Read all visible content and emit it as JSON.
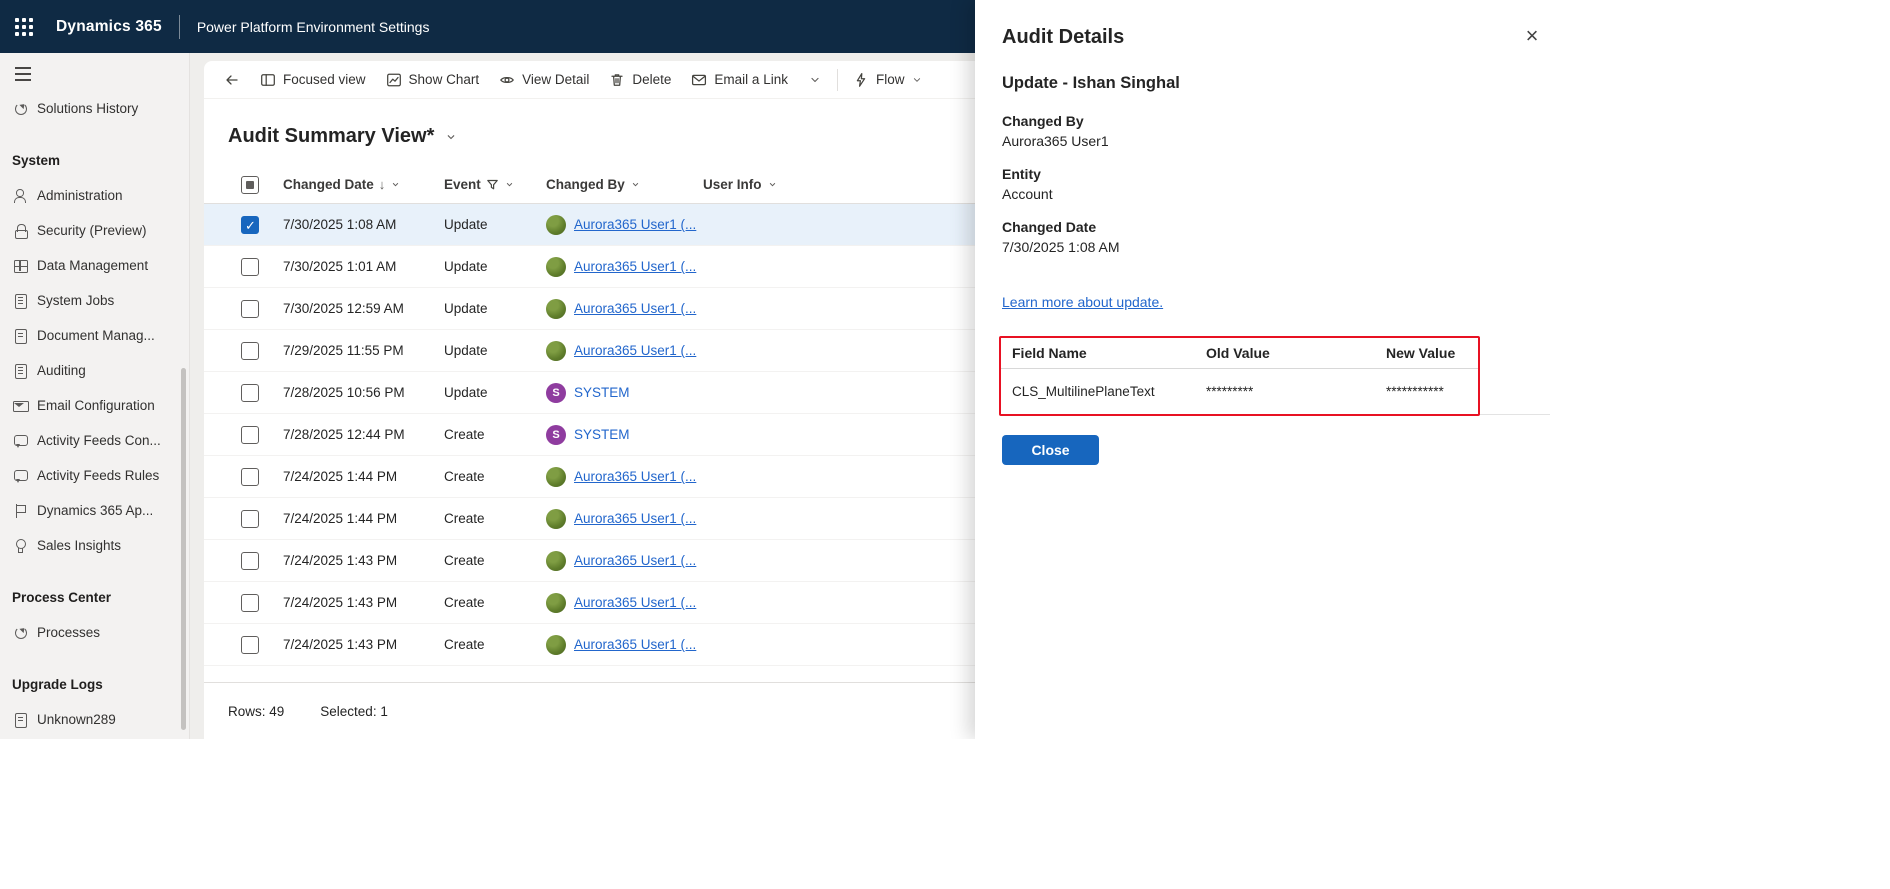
{
  "colors": {
    "topbar_bg": "#0f2a44",
    "accent": "#1766be",
    "link": "#2266cc",
    "selected_row_bg": "#e8f1fa",
    "highlight_border": "#e81123",
    "user_avatar": "#5f7d2b",
    "system_avatar": "#8f3c9f"
  },
  "topbar": {
    "app_name": "Dynamics 365",
    "page_title": "Power Platform Environment Settings"
  },
  "sidebar": {
    "entries": [
      {
        "type": "item",
        "label": "Solutions History",
        "icon": "history-icon"
      },
      {
        "type": "header",
        "label": "System"
      },
      {
        "type": "item",
        "label": "Administration",
        "icon": "people-icon"
      },
      {
        "type": "item",
        "label": "Security (Preview)",
        "icon": "lock-icon"
      },
      {
        "type": "item",
        "label": "Data Management",
        "icon": "database-icon"
      },
      {
        "type": "item",
        "label": "System Jobs",
        "icon": "system-jobs-icon"
      },
      {
        "type": "item",
        "label": "Document Manag...",
        "icon": "document-icon"
      },
      {
        "type": "item",
        "label": "Auditing",
        "icon": "audit-icon"
      },
      {
        "type": "item",
        "label": "Email Configuration",
        "icon": "email-icon"
      },
      {
        "type": "item",
        "label": "Activity Feeds Con...",
        "icon": "feed-icon"
      },
      {
        "type": "item",
        "label": "Activity Feeds Rules",
        "icon": "feed-rules-icon"
      },
      {
        "type": "item",
        "label": "Dynamics 365 Ap...",
        "icon": "apps-icon"
      },
      {
        "type": "item",
        "label": "Sales Insights",
        "icon": "insights-icon"
      },
      {
        "type": "header",
        "label": "Process Center"
      },
      {
        "type": "item",
        "label": "Processes",
        "icon": "processes-icon"
      },
      {
        "type": "header",
        "label": "Upgrade Logs"
      },
      {
        "type": "item",
        "label": "Unknown289",
        "icon": "log-icon"
      }
    ]
  },
  "command_bar": {
    "focused_view": "Focused view",
    "show_chart": "Show Chart",
    "view_detail": "View Detail",
    "delete": "Delete",
    "email_link": "Email a Link",
    "flow": "Flow"
  },
  "view": {
    "title": "Audit Summary View*"
  },
  "grid": {
    "columns": [
      "Changed Date",
      "Event",
      "Changed By",
      "User Info"
    ],
    "rows": [
      {
        "changed_date": "7/30/2025 1:08 AM",
        "event": "Update",
        "changed_by": "Aurora365 User1 (...",
        "avatar": "user",
        "selected": true
      },
      {
        "changed_date": "7/30/2025 1:01 AM",
        "event": "Update",
        "changed_by": "Aurora365 User1 (...",
        "avatar": "user",
        "selected": false
      },
      {
        "changed_date": "7/30/2025 12:59 AM",
        "event": "Update",
        "changed_by": "Aurora365 User1 (...",
        "avatar": "user",
        "selected": false
      },
      {
        "changed_date": "7/29/2025 11:55 PM",
        "event": "Update",
        "changed_by": "Aurora365 User1 (...",
        "avatar": "user",
        "selected": false
      },
      {
        "changed_date": "7/28/2025 10:56 PM",
        "event": "Update",
        "changed_by": "SYSTEM",
        "avatar": "system",
        "selected": false
      },
      {
        "changed_date": "7/28/2025 12:44 PM",
        "event": "Create",
        "changed_by": "SYSTEM",
        "avatar": "system",
        "selected": false
      },
      {
        "changed_date": "7/24/2025 1:44 PM",
        "event": "Create",
        "changed_by": "Aurora365 User1 (...",
        "avatar": "user",
        "selected": false
      },
      {
        "changed_date": "7/24/2025 1:44 PM",
        "event": "Create",
        "changed_by": "Aurora365 User1 (...",
        "avatar": "user",
        "selected": false
      },
      {
        "changed_date": "7/24/2025 1:43 PM",
        "event": "Create",
        "changed_by": "Aurora365 User1 (...",
        "avatar": "user",
        "selected": false
      },
      {
        "changed_date": "7/24/2025 1:43 PM",
        "event": "Create",
        "changed_by": "Aurora365 User1 (...",
        "avatar": "user",
        "selected": false
      },
      {
        "changed_date": "7/24/2025 1:43 PM",
        "event": "Create",
        "changed_by": "Aurora365 User1 (...",
        "avatar": "user",
        "selected": false
      }
    ],
    "footer": {
      "rows": "Rows: 49",
      "selected": "Selected: 1"
    }
  },
  "panel": {
    "title": "Audit Details",
    "heading": "Update - Ishan Singhal",
    "fields": [
      {
        "label": "Changed By",
        "value": "Aurora365 User1"
      },
      {
        "label": "Entity",
        "value": "Account"
      },
      {
        "label": "Changed Date",
        "value": "7/30/2025 1:08 AM"
      }
    ],
    "link": "Learn more about update.",
    "value_table": {
      "columns": [
        "Field Name",
        "Old Value",
        "New Value"
      ],
      "rows": [
        {
          "field": "CLS_MultilinePlaneText",
          "old_value": "*********",
          "new_value": "***********"
        }
      ]
    },
    "close_button": "Close"
  }
}
